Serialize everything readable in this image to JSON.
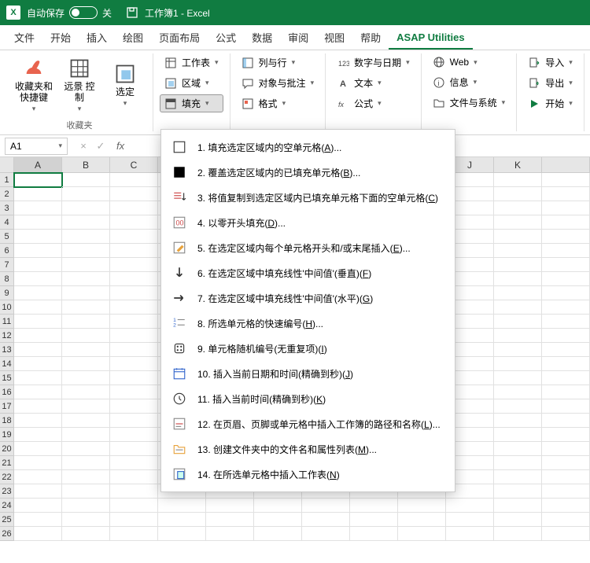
{
  "titlebar": {
    "autosave_label": "自动保存",
    "autosave_state": "关",
    "doc_title": "工作簿1  -  Excel"
  },
  "tabs": [
    "文件",
    "开始",
    "插入",
    "绘图",
    "页面布局",
    "公式",
    "数据",
    "审阅",
    "视图",
    "帮助",
    "ASAP Utilities"
  ],
  "active_tab": 10,
  "ribbon": {
    "group1_label": "收藏夹",
    "fav_shortcuts": "收藏夹和\n快捷键",
    "vision": "远景\n控制",
    "select": "选定",
    "col2": {
      "worksheet": "工作表",
      "area": "区域",
      "fill": "填充"
    },
    "col3": {
      "colrow": "列与行",
      "obj": "对象与批注",
      "format": "格式"
    },
    "col4": {
      "numdate": "数字与日期",
      "text": "文本",
      "formula": "公式"
    },
    "col5": {
      "web": "Web",
      "info": "信息",
      "filesys": "文件与系统"
    },
    "col6": {
      "import": "导入",
      "export": "导出",
      "start": "开始"
    }
  },
  "name_box": "A1",
  "columns": [
    "A",
    "B",
    "C",
    "",
    "",
    "",
    "",
    "",
    "",
    "J",
    "K",
    ""
  ],
  "rows": 26,
  "dropdown": [
    {
      "icon": "square-empty",
      "text": "1.  填充选定区域内的空单元格(A)..."
    },
    {
      "icon": "square-filled",
      "text": "2.  覆盖选定区域内的已填充单元格(B)..."
    },
    {
      "icon": "list-down",
      "text": "3.  将值复制到选定区域内已填充单元格下面的空单元格(C)"
    },
    {
      "icon": "zero-sheet",
      "text": "4.  以零开头填充(D)..."
    },
    {
      "icon": "edit-cell",
      "text": "5.  在选定区域内每个单元格开头和/或末尾插入(E)..."
    },
    {
      "icon": "arrow-down",
      "text": "6.  在选定区域中填充线性'中间值'(垂直)(F)"
    },
    {
      "icon": "arrow-right",
      "text": "7.  在选定区域中填充线性'中间值'(水平)(G)"
    },
    {
      "icon": "number-list",
      "text": "8.  所选单元格的快速编号(H)..."
    },
    {
      "icon": "dice",
      "text": "9.  单元格随机编号(无重复项)(I)"
    },
    {
      "icon": "calendar",
      "text": "10.  插入当前日期和时间(精确到秒)(J)"
    },
    {
      "icon": "clock",
      "text": "11.  插入当前时间(精确到秒)(K)"
    },
    {
      "icon": "path-sheet",
      "text": "12.  在页眉、页脚或单元格中插入工作簿的路径和名称(L)..."
    },
    {
      "icon": "folder-list",
      "text": "13.  创建文件夹中的文件名和属性列表(M)..."
    },
    {
      "icon": "insert-sheet",
      "text": "14.  在所选单元格中插入工作表(N)"
    }
  ]
}
